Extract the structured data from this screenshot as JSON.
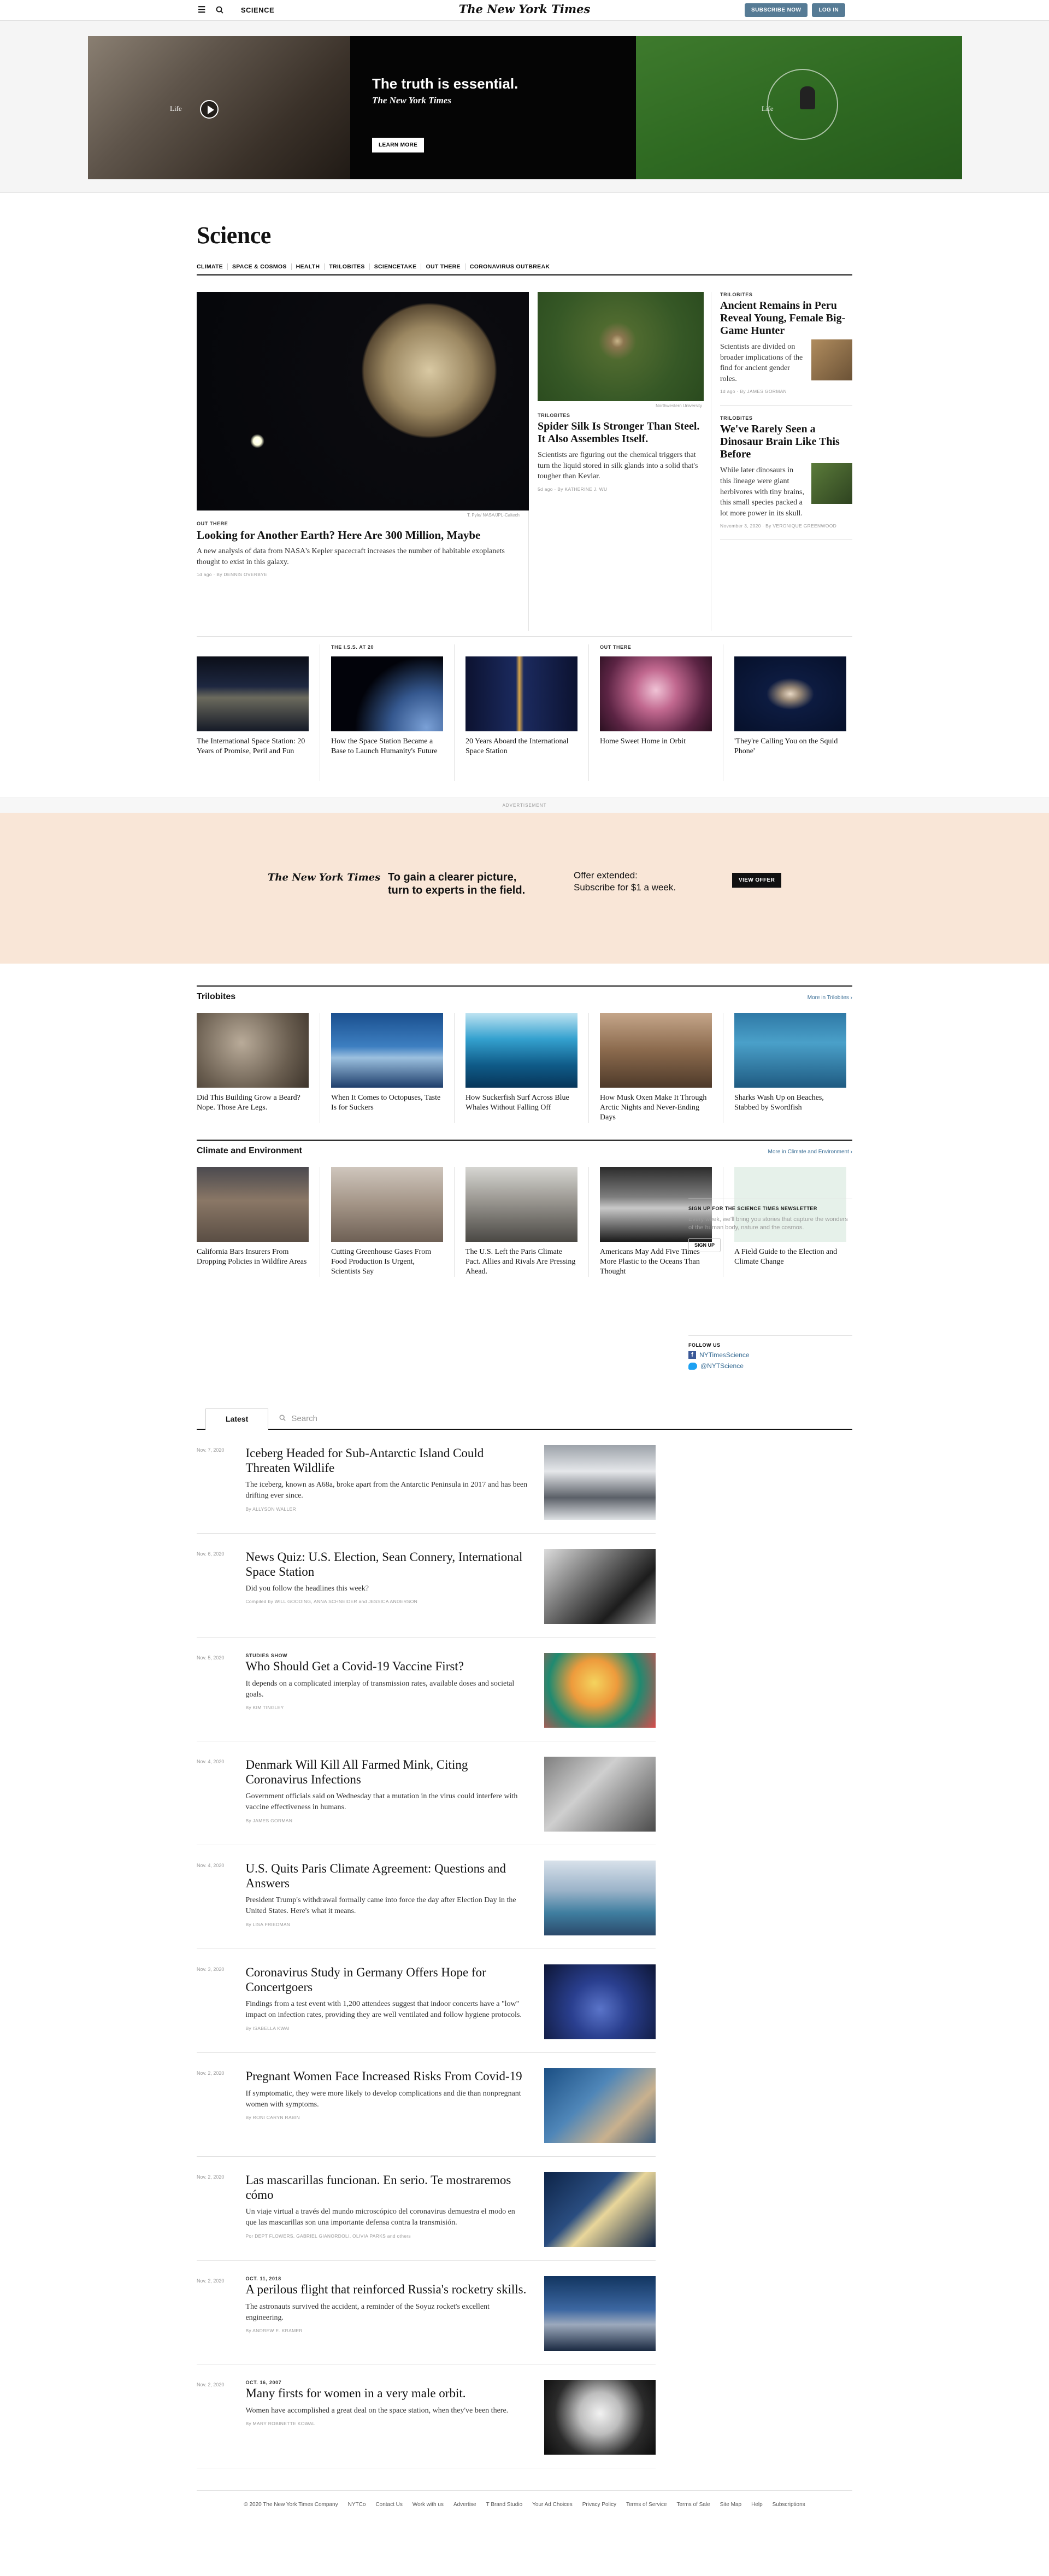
{
  "header": {
    "section": "SCIENCE",
    "logo": "The New York Times",
    "subscribe": "SUBSCRIBE NOW",
    "login": "LOG IN"
  },
  "hero_ad": {
    "left_word": "Life",
    "right_word": "Life",
    "headline": "The truth is essential.",
    "logo": "The New York Times",
    "cta": "LEARN MORE"
  },
  "page": {
    "title": "Science",
    "subnav": [
      "CLIMATE",
      "SPACE & COSMOS",
      "HEALTH",
      "TRILOBITES",
      "SCIENCETAKE",
      "OUT THERE",
      "CORONAVIRUS OUTBREAK"
    ]
  },
  "lead": {
    "credit": "T. Pyle/ NASA/JPL-Caltech",
    "kicker": "OUT THERE",
    "headline": "Looking for Another Earth? Here Are 300 Million, Maybe",
    "summary": "A new analysis of data from NASA's Kepler spacecraft increases the number of habitable exoplanets thought to exist in this galaxy.",
    "meta": "1d ago · By DENNIS OVERBYE"
  },
  "second": {
    "credit": "Northwestern University",
    "kicker": "TRILOBITES",
    "headline": "Spider Silk Is Stronger Than Steel. It Also Assembles Itself.",
    "summary": "Scientists are figuring out the chemical triggers that turn the liquid stored in silk glands into a solid that's tougher than Kevlar.",
    "meta": "5d ago · By KATHERINE J. WU"
  },
  "third": [
    {
      "kicker": "TRILOBITES",
      "headline": "Ancient Remains in Peru Reveal Young, Female Big-Game Hunter",
      "summary": "Scientists are divided on broader implications of the find for ancient gender roles.",
      "meta": "1d ago · By JAMES GORMAN"
    },
    {
      "kicker": "TRILOBITES",
      "headline": "We've Rarely Seen a Dinosaur Brain Like This Before",
      "summary": "While later dinosaurs in this lineage were giant herbivores with tiny brains, this small species packed a lot more power in its skull.",
      "meta": "November 3, 2020 · By VERONIQUE GREENWOOD"
    }
  ],
  "row5": [
    {
      "kicker": "",
      "title": "The International Space Station: 20 Years of Promise, Peril and Fun"
    },
    {
      "kicker": "THE I.S.S. AT 20",
      "title": "How the Space Station Became a Base to Launch Humanity's Future"
    },
    {
      "kicker": "",
      "title": "20 Years Aboard the International Space Station"
    },
    {
      "kicker": "OUT THERE",
      "title": "Home Sweet Home in Orbit"
    },
    {
      "kicker": "",
      "title": "'They're Calling You on the Squid Phone'"
    }
  ],
  "banner": {
    "label": "ADVERTISEMENT",
    "logo": "The New York Times",
    "line1": "To gain a clearer picture,",
    "line2": "turn to experts in the field.",
    "offer1": "Offer extended:",
    "offer2": "Subscribe for $1 a week.",
    "cta": "VIEW OFFER"
  },
  "trilobites": {
    "title": "Trilobites",
    "more": "More in Trilobites ›",
    "items": [
      "Did This Building Grow a Beard? Nope. Those Are Legs.",
      "When It Comes to Octopuses, Taste Is for Suckers",
      "How Suckerfish Surf Across Blue Whales Without Falling Off",
      "How Musk Oxen Make It Through Arctic Nights and Never-Ending Days",
      "Sharks Wash Up on Beaches, Stabbed by Swordfish"
    ]
  },
  "climate": {
    "title": "Climate and Environment",
    "more": "More in Climate and Environment ›",
    "items": [
      "California Bars Insurers From Dropping Policies in Wildfire Areas",
      "Cutting Greenhouse Gases From Food Production Is Urgent, Scientists Say",
      "The U.S. Left the Paris Climate Pact. Allies and Rivals Are Pressing Ahead.",
      "Americans May Add Five Times More Plastic to the Oceans Than Thought",
      "A Field Guide to the Election and Climate Change"
    ]
  },
  "latest": {
    "tab": "Latest",
    "search_placeholder": "Search",
    "items": [
      {
        "date": "Nov. 7, 2020",
        "kicker": "",
        "title": "Iceberg Headed for Sub-Antarctic Island Could Threaten Wildlife",
        "desc": "The iceberg, known as A68a, broke apart from the Antarctic Peninsula in 2017 and has been drifting ever since.",
        "by": "By ALLYSON WALLER"
      },
      {
        "date": "Nov. 6, 2020",
        "kicker": "",
        "title": "News Quiz: U.S. Election, Sean Connery, International Space Station",
        "desc": "Did you follow the headlines this week?",
        "by": "Compiled by WILL GOODING, ANNA SCHNEIDER and JESSICA ANDERSON"
      },
      {
        "date": "Nov. 5, 2020",
        "kicker": "STUDIES SHOW",
        "title": "Who Should Get a Covid-19 Vaccine First?",
        "desc": "It depends on a complicated interplay of transmission rates, available doses and societal goals.",
        "by": "By KIM TINGLEY"
      },
      {
        "date": "Nov. 4, 2020",
        "kicker": "",
        "title": "Denmark Will Kill All Farmed Mink, Citing Coronavirus Infections",
        "desc": "Government officials said on Wednesday that a mutation in the virus could interfere with vaccine effectiveness in humans.",
        "by": "By JAMES GORMAN"
      },
      {
        "date": "Nov. 4, 2020",
        "kicker": "",
        "title": "U.S. Quits Paris Climate Agreement: Questions and Answers",
        "desc": "President Trump's withdrawal formally came into force the day after Election Day in the United States. Here's what it means.",
        "by": "By LISA FRIEDMAN"
      },
      {
        "date": "Nov. 3, 2020",
        "kicker": "",
        "title": "Coronavirus Study in Germany Offers Hope for Concertgoers",
        "desc": "Findings from a test event with 1,200 attendees suggest that indoor concerts have a \"low\" impact on infection rates, providing they are well ventilated and follow hygiene protocols.",
        "by": "By ISABELLA KWAI"
      },
      {
        "date": "Nov. 2, 2020",
        "kicker": "",
        "title": "Pregnant Women Face Increased Risks From Covid-19",
        "desc": "If symptomatic, they were more likely to develop complications and die than nonpregnant women with symptoms.",
        "by": "By RONI CARYN RABIN"
      },
      {
        "date": "Nov. 2, 2020",
        "kicker": "",
        "title": "Las mascarillas funcionan. En serio. Te mostraremos cómo",
        "desc": "Un viaje virtual a través del mundo microscópico del coronavirus demuestra el modo en que las mascarillas son una importante defensa contra la transmisión.",
        "by": "Por DEPT FLOWERS, GABRIEL GIANORDOLI, OLIVIA PARKS and others"
      },
      {
        "date": "Nov. 2, 2020",
        "kicker": "OCT. 11, 2018",
        "title": "A perilous flight that reinforced Russia's rocketry skills.",
        "desc": "The astronauts survived the accident, a reminder of the Soyuz rocket's excellent engineering.",
        "by": "By ANDREW E. KRAMER"
      },
      {
        "date": "Nov. 2, 2020",
        "kicker": "OCT. 16, 2007",
        "title": "Many firsts for women in a very male orbit.",
        "desc": "Women have accomplished a great deal on the space station, when they've been there.",
        "by": "By MARY ROBINETTE KOWAL"
      }
    ]
  },
  "sidebar": {
    "newsletter_title": "SIGN UP FOR THE SCIENCE TIMES NEWSLETTER",
    "newsletter_text": "Every week, we'll bring you stories that capture the wonders of the human body, nature and the cosmos.",
    "signup": "SIGN UP",
    "follow": "FOLLOW US",
    "facebook": "NYTimesScience",
    "twitter": "@NYTScience"
  },
  "footer": [
    "© 2020 The New York Times Company",
    "NYTCo",
    "Contact Us",
    "Work with us",
    "Advertise",
    "T Brand Studio",
    "Your Ad Choices",
    "Privacy Policy",
    "Terms of Service",
    "Terms of Sale",
    "Site Map",
    "Help",
    "Subscriptions"
  ]
}
